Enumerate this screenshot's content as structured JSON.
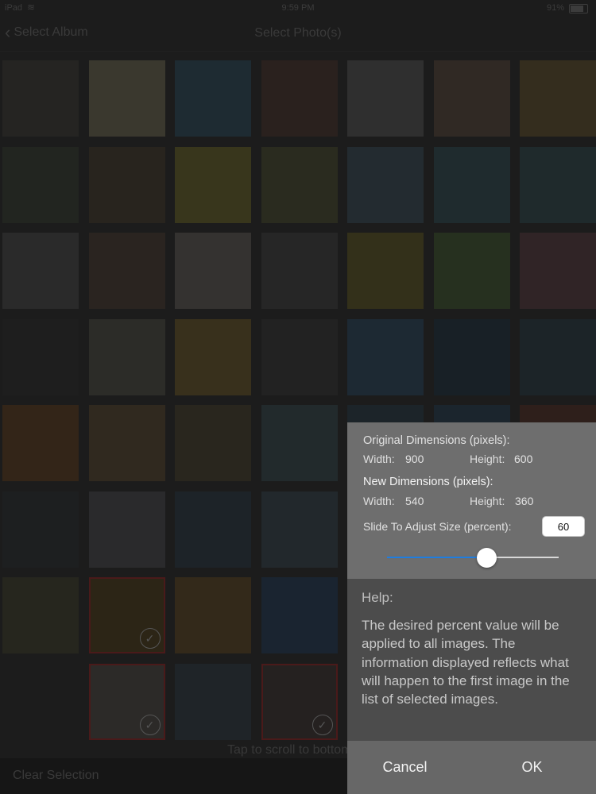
{
  "status_bar": {
    "carrier": "iPad",
    "time": "9:59 PM",
    "battery": "91%"
  },
  "navbar": {
    "back_label": "Select Album",
    "title": "Select Photo(s)"
  },
  "grid": {
    "rows": 8,
    "cols": 7,
    "cells": [
      {
        "color": "#252422"
      },
      {
        "color": "#3a382e"
      },
      {
        "color": "#1e2b32"
      },
      {
        "color": "#2a211e"
      },
      {
        "color": "#2f2f2f"
      },
      {
        "color": "#302924"
      },
      {
        "color": "#342d1e"
      },
      {
        "color": "#222520"
      },
      {
        "color": "#28241e"
      },
      {
        "color": "#38361c"
      },
      {
        "color": "#2a2b1f"
      },
      {
        "color": "#232b30"
      },
      {
        "color": "#1f2b2e"
      },
      {
        "color": "#1f2a2c"
      },
      {
        "color": "#2a2a2a"
      },
      {
        "color": "#2a2420"
      },
      {
        "color": "#343230"
      },
      {
        "color": "#262626"
      },
      {
        "color": "#33301a"
      },
      {
        "color": "#26301f"
      },
      {
        "color": "#302426"
      },
      {
        "color": "#1e1e1e"
      },
      {
        "color": "#2c2c28"
      },
      {
        "color": "#38301c"
      },
      {
        "color": "#222222"
      },
      {
        "color": "#1d2933"
      },
      {
        "color": "#182026"
      },
      {
        "color": "#1c2428"
      },
      {
        "color": "#332518"
      },
      {
        "color": "#30291f"
      },
      {
        "color": "#29261e"
      },
      {
        "color": "#222a2c"
      },
      {
        "color": "#1c2429"
      },
      {
        "color": "#1b252d"
      },
      {
        "color": "#2e1f1b"
      },
      {
        "color": "#1d1f20"
      },
      {
        "color": "#2a2a2c"
      },
      {
        "color": "#1d2328"
      },
      {
        "color": "#22282c"
      },
      {
        "color": "#202a30"
      },
      {
        "color": "#1f272d"
      },
      {
        "color": "#21292c"
      },
      {
        "color": "#26261e",
        "selected": false
      },
      {
        "color": "#2c2516",
        "selected": true
      },
      {
        "color": "#33291a"
      },
      {
        "color": "#1a2430"
      },
      {
        "color": "#1e252a"
      },
      {
        "color": "#262626"
      },
      {
        "color": "#1c2226"
      },
      {
        "color": "#1c1c1c"
      },
      {
        "color": "#2c2a28",
        "selected": true
      },
      {
        "color": "#1f2428"
      },
      {
        "color": "#252120",
        "selected": true
      },
      {
        "color": "#1e2226"
      },
      {
        "color": "#222"
      },
      {
        "color": "#222"
      }
    ]
  },
  "scroll_hint": "Tap to scroll to bottom",
  "bottom_bar": {
    "clear_label": "Clear Selection"
  },
  "resize_popup": {
    "original_heading": "Original Dimensions (pixels):",
    "original_width_label": "Width:",
    "original_width": "900",
    "original_height_label": "Height:",
    "original_height": "600",
    "new_heading": "New Dimensions (pixels):",
    "new_width_label": "Width:",
    "new_width": "540",
    "new_height_label": "Height:",
    "new_height": "360",
    "slide_label": "Slide To Adjust Size (percent):",
    "percent_value": "60",
    "slider_fraction": 0.58,
    "slider_fill_color": "#1e7de0"
  },
  "help": {
    "title": "Help:",
    "body": "The desired percent value will be applied to all images. The information displayed reflects what will happen to the first image in the list of selected images."
  },
  "actions": {
    "cancel_label": "Cancel",
    "ok_label": "OK"
  }
}
